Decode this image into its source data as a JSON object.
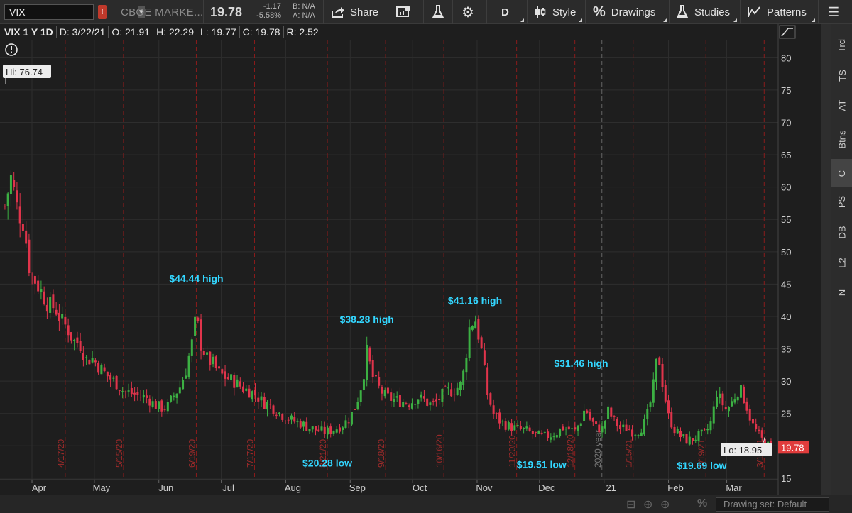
{
  "toolbar": {
    "symbol": "VIX",
    "company": "CBOE MARKE...",
    "last": "19.78",
    "net_change": "-1.17",
    "pct_change": "-5.58%",
    "bid": "B: N/A",
    "ask": "A: N/A",
    "share": "Share",
    "period": "D",
    "style": "Style",
    "drawings": "Drawings",
    "studies": "Studies",
    "patterns": "Patterns"
  },
  "header": {
    "title": "VIX 1 Y 1D",
    "date": "D: 3/22/21",
    "open": "O: 21.91",
    "high": "H: 22.29",
    "low": "L: 19.77",
    "close": "C: 19.78",
    "range": "R: 2.52"
  },
  "right_tabs": [
    "Trd",
    "TS",
    "AT",
    "Btns",
    "C",
    "PS",
    "DB",
    "L2",
    "N"
  ],
  "status": {
    "drawing_set": "Drawing set: Default"
  },
  "colors": {
    "up": "#3cb043",
    "down": "#e0344b",
    "annotation": "#33d6ff",
    "grid": "#2e2e2e",
    "event_line": "#8a1b1b",
    "price_tag": "#e03c3c"
  },
  "chart_data": {
    "type": "candlestick",
    "ylim": [
      14,
      83
    ],
    "yticks": [
      15,
      20,
      25,
      30,
      35,
      40,
      45,
      50,
      55,
      60,
      65,
      70,
      75,
      80
    ],
    "ytick_labels": [
      "15",
      "20",
      "25",
      "30",
      "35",
      "40",
      "45",
      "50",
      "55",
      "60",
      "65",
      "70",
      "75",
      "80"
    ],
    "months": [
      {
        "label": "Apr",
        "day": 14
      },
      {
        "label": "May",
        "day": 44
      },
      {
        "label": "Jun",
        "day": 75
      },
      {
        "label": "Jul",
        "day": 105
      },
      {
        "label": "Aug",
        "day": 136
      },
      {
        "label": "Sep",
        "day": 167
      },
      {
        "label": "Oct",
        "day": 197
      },
      {
        "label": "Nov",
        "day": 228
      },
      {
        "label": "Dec",
        "day": 258
      },
      {
        "label": "21",
        "day": 289
      },
      {
        "label": "Feb",
        "day": 320
      },
      {
        "label": "Mar",
        "day": 348
      }
    ],
    "event_lines": [
      {
        "label": "4/17/20",
        "day": 30
      },
      {
        "label": "5/15/20",
        "day": 58
      },
      {
        "label": "6/19/20",
        "day": 93
      },
      {
        "label": "7/17/20",
        "day": 121
      },
      {
        "label": "8/21/20",
        "day": 156
      },
      {
        "label": "9/18/20",
        "day": 184
      },
      {
        "label": "10/16/20",
        "day": 212
      },
      {
        "label": "11/20/20",
        "day": 247
      },
      {
        "label": "12/18/20",
        "day": 275
      },
      {
        "label": "2020 year",
        "day": 288,
        "year": true
      },
      {
        "label": "1/15/21",
        "day": 303
      },
      {
        "label": "2/19/21",
        "day": 338
      },
      {
        "label": "3/19/21",
        "day": 366
      }
    ],
    "annotations": [
      {
        "text": "$44.44 high",
        "day": 93,
        "value": 45.3
      },
      {
        "text": "$38.28 high",
        "day": 175,
        "value": 39.0
      },
      {
        "text": "$41.16 high",
        "day": 227,
        "value": 41.9
      },
      {
        "text": "$31.46 high",
        "day": 278,
        "value": 32.2
      },
      {
        "text": "$20.28 low",
        "day": 156,
        "value": 16.8
      },
      {
        "text": "$19.51 low",
        "day": 259,
        "value": 16.6
      },
      {
        "text": "$19.69 low",
        "day": 336,
        "value": 16.4
      }
    ],
    "hi_label": "Hi: 76.74",
    "lo_label": "Lo: 18.95",
    "last_tag": "19.78",
    "last_value": 19.78,
    "days_first": 0,
    "days_last": 370,
    "closes": [
      [
        1,
        57.1
      ],
      [
        4,
        61.6
      ],
      [
        7,
        56.6
      ],
      [
        10,
        54.5
      ],
      [
        13,
        46.8
      ],
      [
        16,
        45.3
      ],
      [
        19,
        43.5
      ],
      [
        22,
        41.7
      ],
      [
        25,
        41.4
      ],
      [
        28,
        39.4
      ],
      [
        31,
        38.2
      ],
      [
        34,
        36.2
      ],
      [
        37,
        35.9
      ],
      [
        40,
        33.3
      ],
      [
        43,
        33.5
      ],
      [
        46,
        32.4
      ],
      [
        49,
        31.2
      ],
      [
        52,
        30.3
      ],
      [
        55,
        29.6
      ],
      [
        58,
        28.4
      ],
      [
        61,
        28.2
      ],
      [
        64,
        27.9
      ],
      [
        67,
        27.6
      ],
      [
        70,
        27.3
      ],
      [
        73,
        26.3
      ],
      [
        76,
        25.9
      ],
      [
        79,
        26.0
      ],
      [
        82,
        27.7
      ],
      [
        85,
        29.0
      ],
      [
        88,
        31.7
      ],
      [
        91,
        36.0
      ],
      [
        93,
        40.2
      ],
      [
        95,
        35.9
      ],
      [
        98,
        33.5
      ],
      [
        101,
        32.7
      ],
      [
        104,
        31.2
      ],
      [
        107,
        30.6
      ],
      [
        110,
        30.2
      ],
      [
        113,
        29.5
      ],
      [
        116,
        28.8
      ],
      [
        119,
        28.4
      ],
      [
        122,
        27.8
      ],
      [
        125,
        26.7
      ],
      [
        128,
        26.4
      ],
      [
        131,
        25.6
      ],
      [
        134,
        24.8
      ],
      [
        137,
        24.3
      ],
      [
        140,
        23.8
      ],
      [
        143,
        23.5
      ],
      [
        146,
        23.0
      ],
      [
        149,
        22.6
      ],
      [
        152,
        22.3
      ],
      [
        155,
        22.1
      ],
      [
        158,
        22.4
      ],
      [
        161,
        22.8
      ],
      [
        164,
        23.4
      ],
      [
        167,
        24.5
      ],
      [
        170,
        26.5
      ],
      [
        173,
        30.2
      ],
      [
        175,
        34.5
      ],
      [
        178,
        30.5
      ],
      [
        181,
        28.8
      ],
      [
        184,
        27.6
      ],
      [
        187,
        27.2
      ],
      [
        190,
        27.0
      ],
      [
        193,
        26.8
      ],
      [
        196,
        26.7
      ],
      [
        199,
        27.5
      ],
      [
        202,
        27.2
      ],
      [
        205,
        26.4
      ],
      [
        208,
        26.6
      ],
      [
        211,
        27.8
      ],
      [
        214,
        28.4
      ],
      [
        217,
        28.6
      ],
      [
        220,
        29.4
      ],
      [
        222,
        32.0
      ],
      [
        224,
        38.0
      ],
      [
        227,
        39.8
      ],
      [
        230,
        35.0
      ],
      [
        233,
        28.0
      ],
      [
        236,
        24.8
      ],
      [
        239,
        23.8
      ],
      [
        242,
        23.2
      ],
      [
        245,
        22.8
      ],
      [
        248,
        22.6
      ],
      [
        251,
        22.4
      ],
      [
        254,
        22.0
      ],
      [
        257,
        21.6
      ],
      [
        260,
        21.4
      ],
      [
        263,
        21.6
      ],
      [
        266,
        22.0
      ],
      [
        269,
        22.8
      ],
      [
        272,
        22.6
      ],
      [
        275,
        22.2
      ],
      [
        278,
        24.0
      ],
      [
        280,
        26.0
      ],
      [
        282,
        24.2
      ],
      [
        285,
        22.9
      ],
      [
        288,
        22.5
      ],
      [
        291,
        25.4
      ],
      [
        294,
        23.8
      ],
      [
        297,
        22.6
      ],
      [
        300,
        22.8
      ],
      [
        303,
        22.1
      ],
      [
        306,
        22.4
      ],
      [
        309,
        23.8
      ],
      [
        312,
        27.5
      ],
      [
        315,
        34.5
      ],
      [
        317,
        30.0
      ],
      [
        320,
        24.5
      ],
      [
        323,
        22.5
      ],
      [
        326,
        21.4
      ],
      [
        329,
        20.8
      ],
      [
        332,
        21.1
      ],
      [
        335,
        21.6
      ],
      [
        338,
        22.0
      ],
      [
        341,
        24.0
      ],
      [
        343,
        28.5
      ],
      [
        345,
        27.0
      ],
      [
        348,
        25.5
      ],
      [
        351,
        27.0
      ],
      [
        354,
        29.0
      ],
      [
        357,
        26.8
      ],
      [
        360,
        23.5
      ],
      [
        363,
        21.8
      ],
      [
        366,
        20.5
      ],
      [
        369,
        19.8
      ]
    ]
  }
}
